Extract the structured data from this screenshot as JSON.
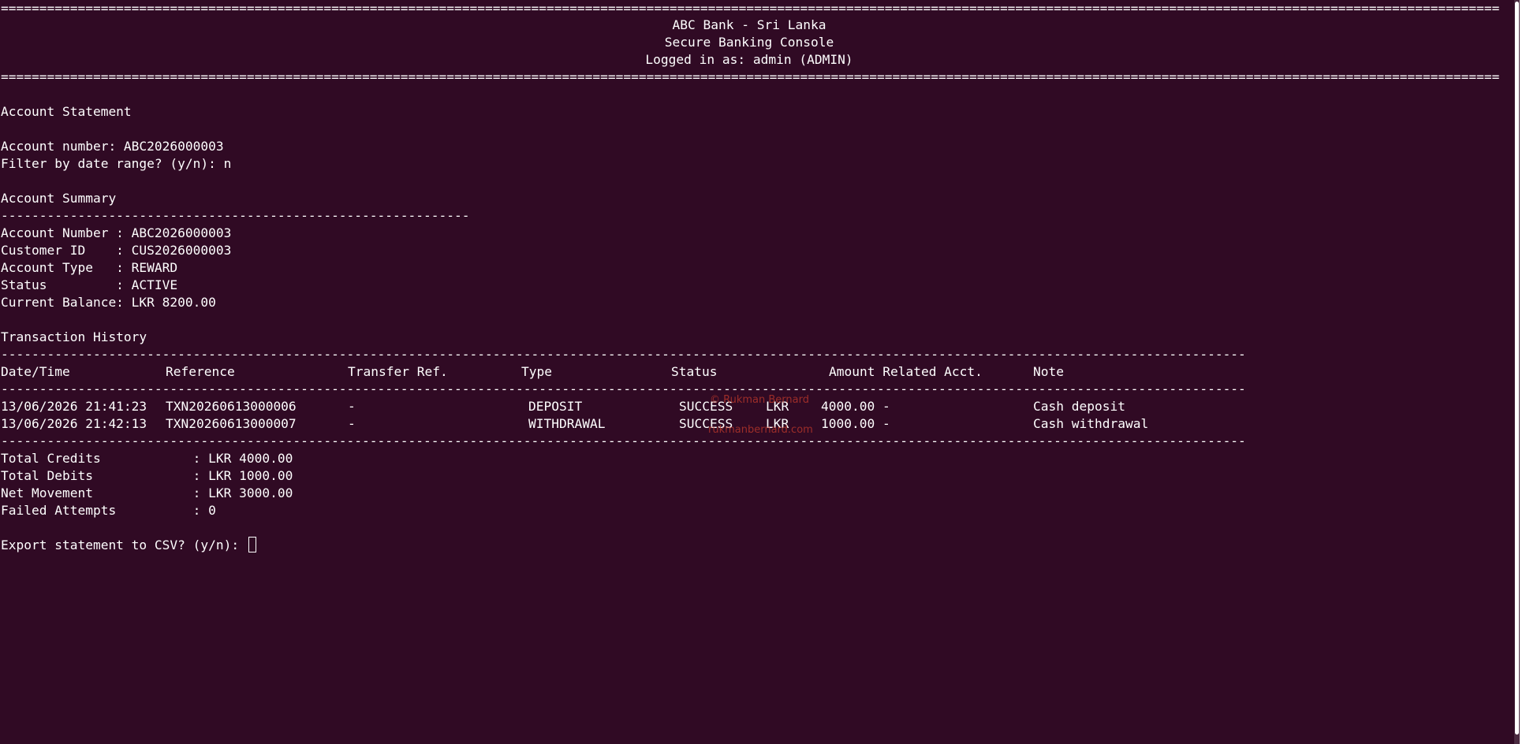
{
  "rules": {
    "double": "============================================================================================================================================================================================================",
    "single_summary": "-------------------------------------------------------------",
    "single_table": "------------------------------------------------------------------------------------------------------------------------------------------------------------------"
  },
  "header": {
    "bank_name": "ABC Bank - Sri Lanka",
    "console_title": "Secure Banking Console",
    "login_status": "Logged in as: admin (ADMIN)"
  },
  "statement": {
    "title": "Account Statement",
    "account_prompt": "Account number: ABC2026000003",
    "filter_prompt": "Filter by date range? (y/n): n"
  },
  "summary": {
    "title": "Account Summary",
    "lines": [
      "Account Number : ABC2026000003",
      "Customer ID    : CUS2026000003",
      "Account Type   : REWARD",
      "Status         : ACTIVE",
      "Current Balance: LKR 8200.00"
    ]
  },
  "history": {
    "title": "Transaction History",
    "columns": {
      "datetime": "Date/Time",
      "reference": "Reference",
      "transfer_ref": "Transfer Ref.",
      "type": "Type",
      "status": "Status",
      "amount_related": "Amount Related Acct.",
      "note": "Note"
    },
    "rows": [
      {
        "datetime": "13/06/2026 21:41:23",
        "reference": "TXN20260613000006",
        "transfer_ref": "-",
        "type": "DEPOSIT",
        "status": "SUCCESS",
        "currency": "LKR",
        "amount": "4000.00 -",
        "note": "Cash deposit"
      },
      {
        "datetime": "13/06/2026 21:42:13",
        "reference": "TXN20260613000007",
        "transfer_ref": "-",
        "type": "WITHDRAWAL",
        "status": "SUCCESS",
        "currency": "LKR",
        "amount": "1000.00 -",
        "note": "Cash withdrawal"
      }
    ]
  },
  "totals": {
    "lines": [
      "Total Credits            : LKR 4000.00",
      "Total Debits             : LKR 1000.00",
      "Net Movement             : LKR 3000.00",
      "Failed Attempts          : 0"
    ]
  },
  "prompt": {
    "export": "Export statement to CSV? (y/n): "
  },
  "watermark": {
    "line1": "© Rukman Bernard",
    "line2": "rukmanbernard.com"
  },
  "colors": {
    "background": "#300a24",
    "text": "#ffffff",
    "watermark": "#c0392b"
  }
}
